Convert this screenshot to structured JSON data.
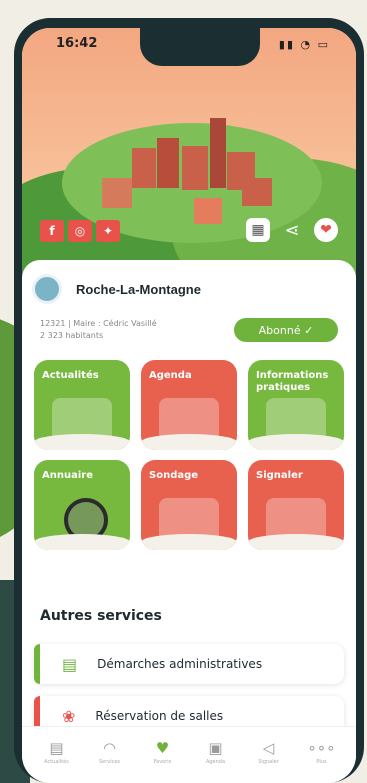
{
  "status": {
    "time": "16:42",
    "icons": "▮▮ ◔ ▭"
  },
  "social": {
    "facebook": "f",
    "instagram": "◎",
    "twitter": "✦"
  },
  "town": {
    "name": "Roche-La-Montagne",
    "meta_line1": "12321 | Maire : Cédric Vasillé",
    "meta_line2": "2 323 habitants",
    "subscribe_label": "Abonné ✓"
  },
  "tiles": [
    {
      "label": "Actualités",
      "color": "green"
    },
    {
      "label": "Agenda",
      "color": "red"
    },
    {
      "label": "Informations pratiques",
      "color": "green"
    },
    {
      "label": "Annuaire",
      "color": "green"
    },
    {
      "label": "Sondage",
      "color": "red"
    },
    {
      "label": "Signaler",
      "color": "red"
    }
  ],
  "services": {
    "title": "Autres services",
    "items": [
      {
        "label": "Démarches administratives",
        "icon": "document-icon",
        "accent": "#6fb33d"
      },
      {
        "label": "Réservation de salles",
        "icon": "balloons-icon",
        "accent": "#e8524a"
      }
    ]
  },
  "tabbar": [
    {
      "label": "Actualités",
      "icon": "news-icon"
    },
    {
      "label": "Services",
      "icon": "services-icon"
    },
    {
      "label": "Favoris",
      "icon": "heart-icon"
    },
    {
      "label": "Agenda",
      "icon": "calendar-icon"
    },
    {
      "label": "Signaler",
      "icon": "megaphone-icon"
    },
    {
      "label": "Plus",
      "icon": "more-icon"
    }
  ],
  "colors": {
    "green": "#77b83e",
    "red": "#e8614f",
    "accent": "#6fb33d"
  }
}
